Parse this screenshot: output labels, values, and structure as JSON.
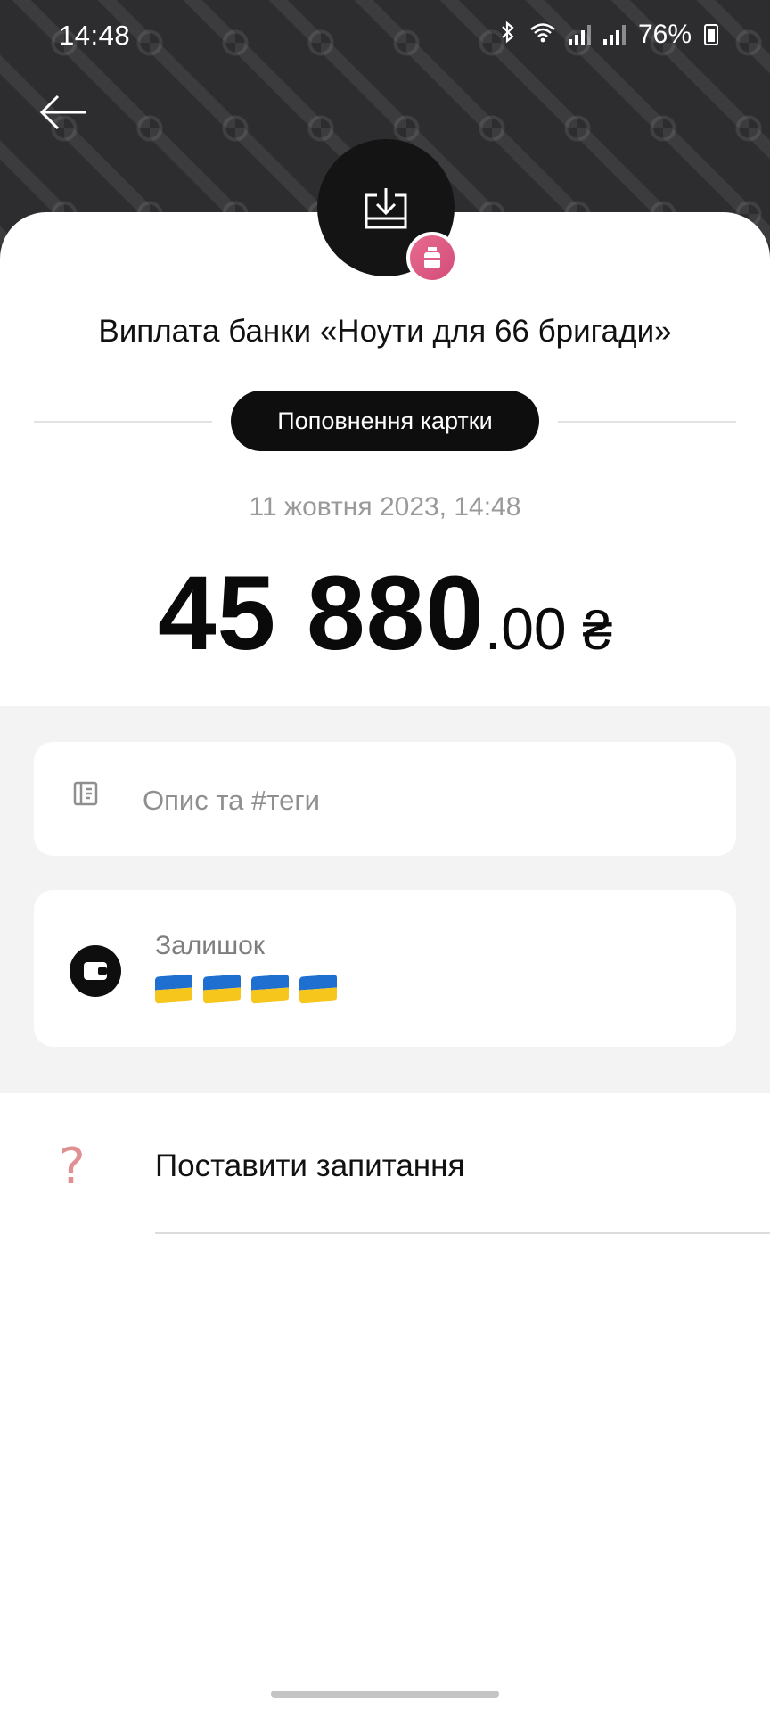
{
  "status_bar": {
    "time": "14:48",
    "battery_percent": "76%",
    "icons": [
      "bluetooth-icon",
      "wifi-icon",
      "signal-icon",
      "signal-icon",
      "battery-icon"
    ]
  },
  "header": {
    "back_icon": "arrow-left-icon",
    "background_color": "#2d2d30"
  },
  "transaction": {
    "title": "Виплата банки «Ноути для 66 бригади»",
    "category": "Поповнення картки",
    "datetime": "11 жовтня 2023, 14:48",
    "amount_integer": "45 880",
    "amount_decimal": ".00",
    "currency_symbol": "₴",
    "avatar_icon": "incoming-tray-icon",
    "badge_icon": "jar-icon",
    "badge_color": "#e05f86"
  },
  "description": {
    "placeholder": "Опис та #теги",
    "icon": "note-icon"
  },
  "balance": {
    "label": "Залишок",
    "icon": "wallet-icon",
    "hidden_value_flags": [
      "ua-flag",
      "ua-flag",
      "ua-flag",
      "ua-flag"
    ]
  },
  "ask": {
    "label": "Поставити запитання",
    "icon": "question-mark-icon",
    "icon_color": "#e08f92"
  }
}
